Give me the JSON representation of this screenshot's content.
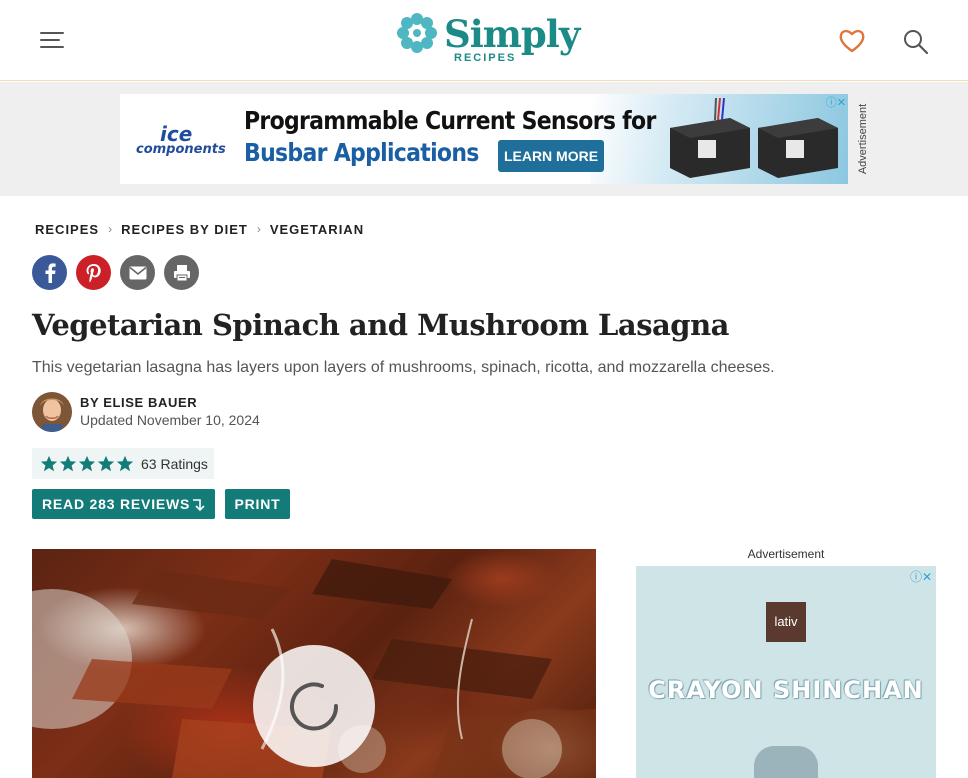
{
  "header": {
    "logo_word": "Simply",
    "logo_sub": "RECIPES"
  },
  "top_ad": {
    "brand_line1": "ice",
    "brand_line2": "components",
    "headline1": "Programmable Current Sensors for",
    "headline2": "Busbar Applications",
    "cta": "LEARN MORE",
    "label": "Advertisement"
  },
  "breadcrumb": [
    "RECIPES",
    "RECIPES BY DIET",
    "VEGETARIAN"
  ],
  "article": {
    "title": "Vegetarian Spinach and Mushroom Lasagna",
    "dek": "This vegetarian lasagna has layers upon layers of mushrooms, spinach, ricotta, and mozzarella cheeses.",
    "byline": "BY ELISE BAUER",
    "updated": "Updated November 10, 2024",
    "rating_count": "63 Ratings",
    "stars": 5,
    "reviews_button": "READ 283 REVIEWS",
    "print_button": "PRINT"
  },
  "side_ad": {
    "label": "Advertisement",
    "brand": "lativ",
    "headline": "CRAYON SHINCHAN"
  },
  "colors": {
    "brand_teal": "#137c78",
    "heart_orange": "#e0743a",
    "facebook": "#3b5998",
    "pinterest": "#cb2027"
  }
}
